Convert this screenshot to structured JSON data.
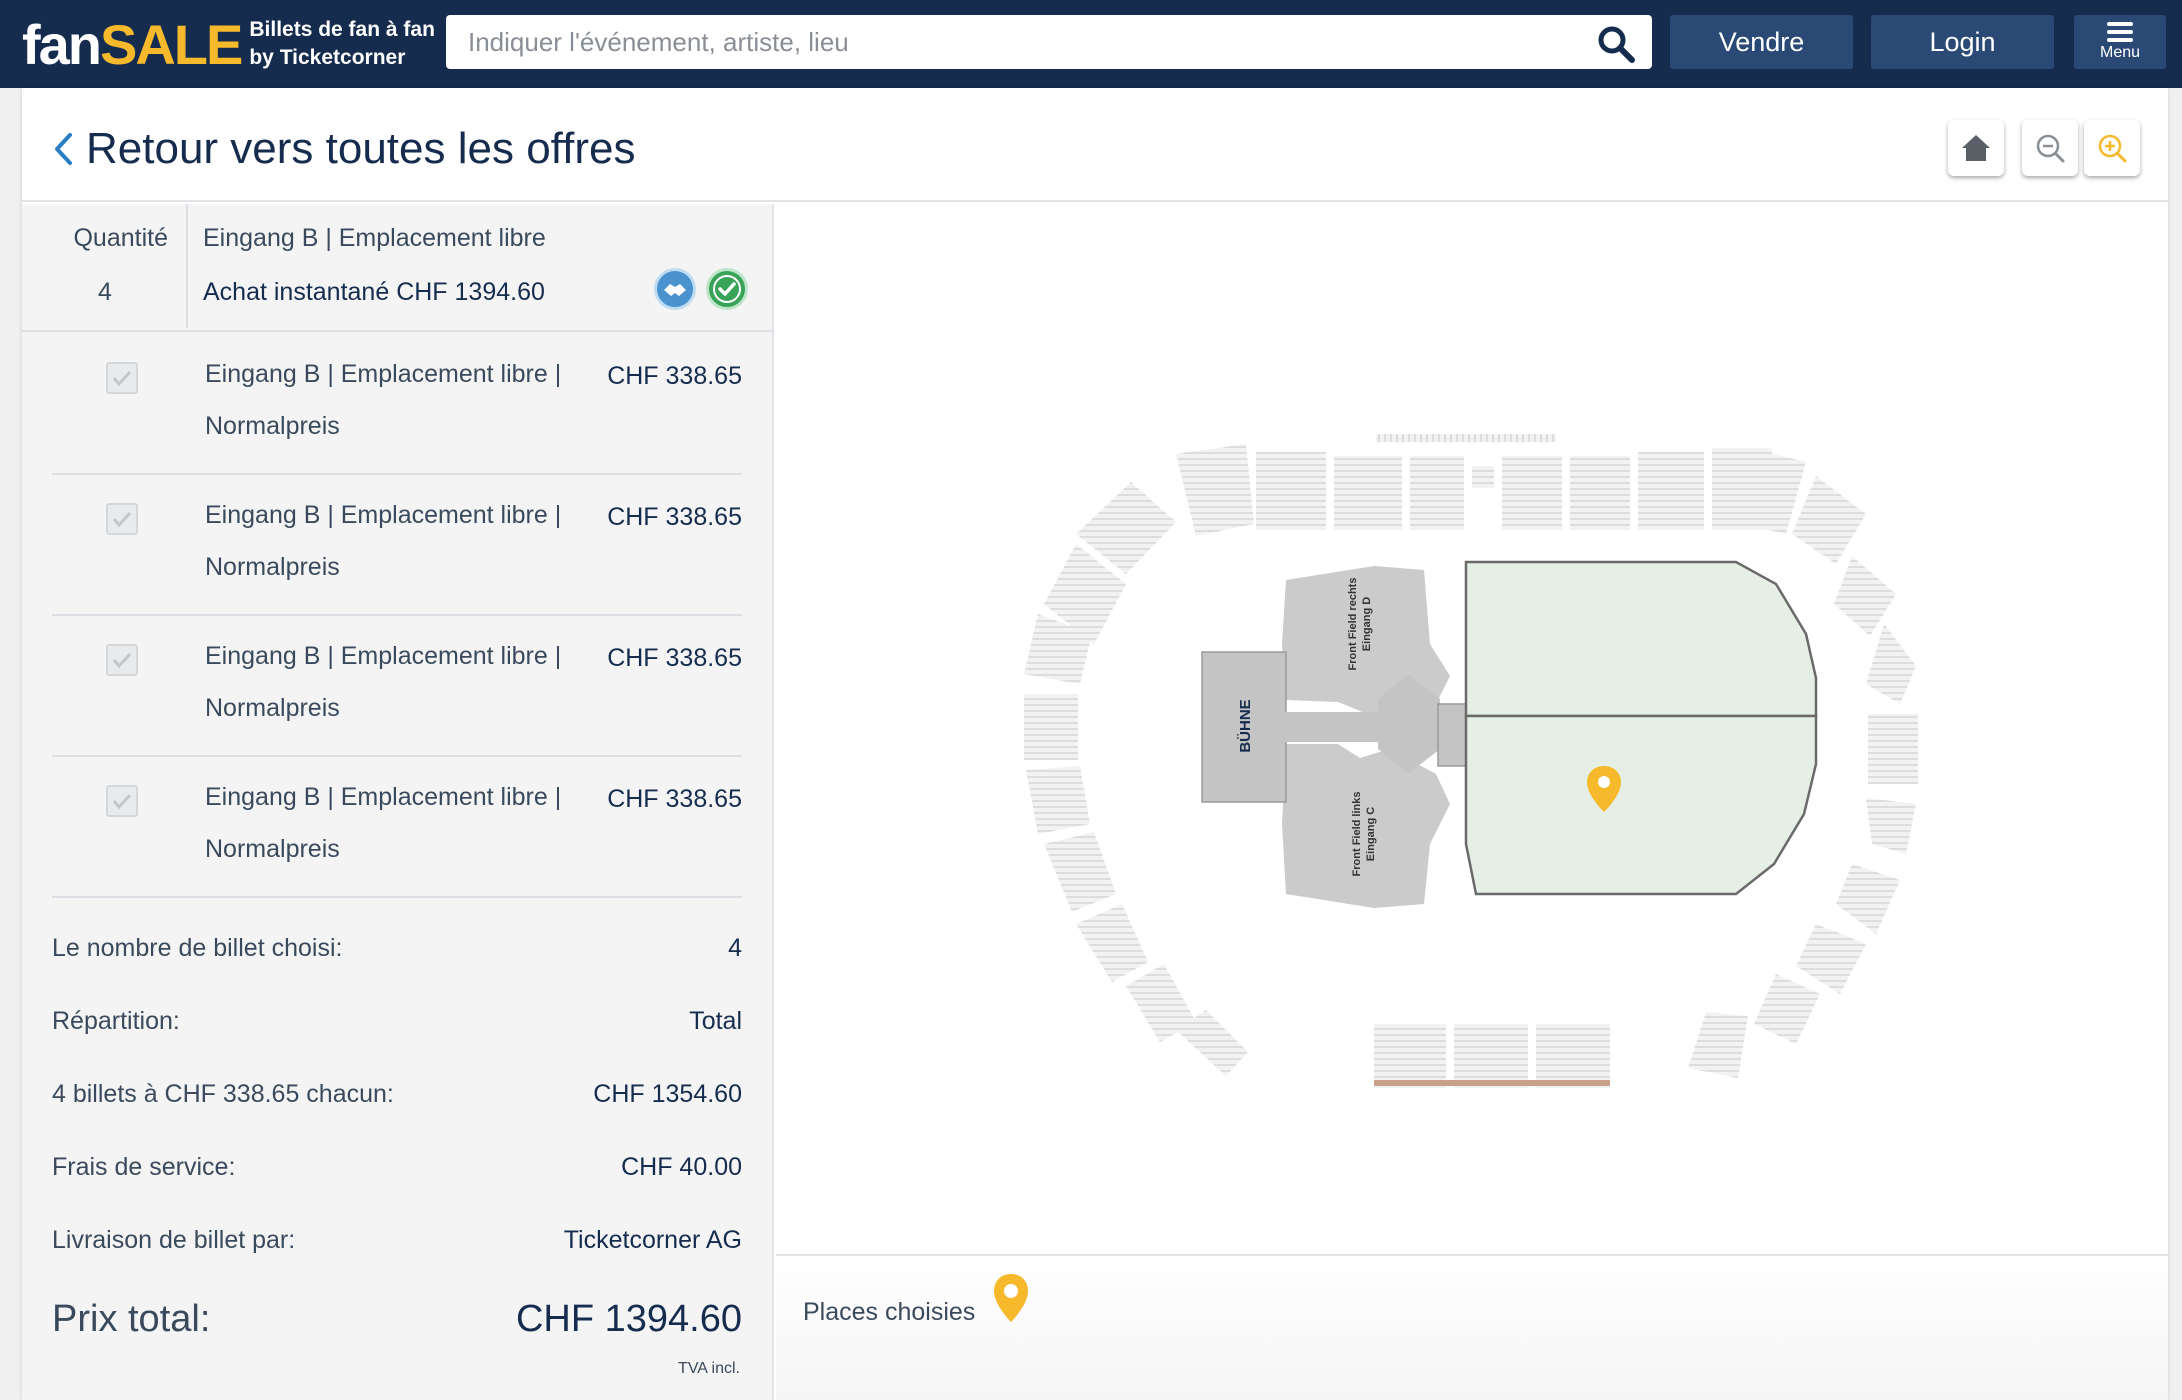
{
  "header": {
    "logo_fan": "fan",
    "logo_sale": "SALE",
    "logo_tagline_1": "Billets de fan à fan",
    "logo_tagline_2": "by Ticketcorner",
    "search_placeholder": "Indiquer l'événement, artiste, lieu",
    "search_icon": "search-icon",
    "sell_label": "Vendre",
    "login_label": "Login",
    "menu_label": "Menu",
    "menu_icon": "hamburger-icon"
  },
  "back": {
    "title": "Retour vers toutes les offres",
    "icon": "chevron-left-icon"
  },
  "map_controls": {
    "home_icon": "home-icon",
    "zoom_out_icon": "zoom-out-icon",
    "zoom_in_icon": "zoom-in-icon"
  },
  "offer": {
    "quantity_label": "Quantité",
    "quantity_value": "4",
    "title": "Eingang B | Emplacement libre",
    "instant_buy": "Achat instantané CHF 1394.60",
    "badges": [
      "handshake-icon",
      "check-icon"
    ]
  },
  "tickets": [
    {
      "desc_1": "Eingang B | Emplacement libre |",
      "desc_2": "Normalpreis",
      "price": "CHF 338.65",
      "checked": true
    },
    {
      "desc_1": "Eingang B | Emplacement libre |",
      "desc_2": "Normalpreis",
      "price": "CHF 338.65",
      "checked": true
    },
    {
      "desc_1": "Eingang B | Emplacement libre |",
      "desc_2": "Normalpreis",
      "price": "CHF 338.65",
      "checked": true
    },
    {
      "desc_1": "Eingang B | Emplacement libre |",
      "desc_2": "Normalpreis",
      "price": "CHF 338.65",
      "checked": true
    }
  ],
  "summary": {
    "count_label": "Le nombre de billet choisi:",
    "count_value": "4",
    "split_label": "Répartition:",
    "split_value": "Total",
    "unit_label": "4 billets à CHF 338.65 chacun:",
    "unit_value": "CHF 1354.60",
    "fee_label": "Frais de service:",
    "fee_value": "CHF 40.00",
    "delivery_label": "Livraison de billet par:",
    "delivery_value": "Ticketcorner AG",
    "total_label": "Prix total:",
    "total_value": "CHF 1394.60",
    "vat_note": "TVA incl."
  },
  "map": {
    "stage_label": "BÜHNE",
    "front_right_label": "Front Field rechts",
    "front_right_sub": "Eingang D",
    "front_left_label": "Front Field links",
    "front_left_sub": "Eingang C",
    "selected_pin_icon": "map-pin-icon"
  },
  "places": {
    "label": "Places choisies",
    "pin_icon": "map-pin-icon"
  },
  "colors": {
    "navy": "#152c4e",
    "button_blue": "#2a4a75",
    "accent_yellow": "#f6b92b",
    "field_green": "#e6efe6"
  }
}
